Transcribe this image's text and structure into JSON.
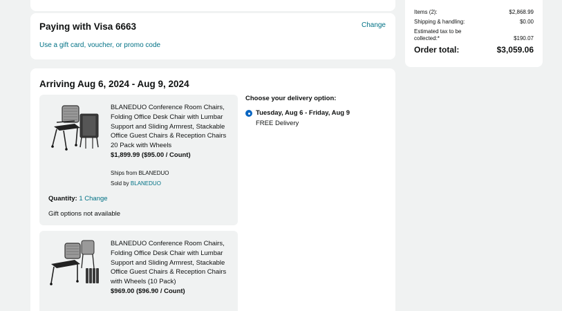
{
  "payment": {
    "title": "Paying with Visa 6663",
    "change_label": "Change",
    "gift_link": "Use a gift card, voucher, or promo code"
  },
  "shipment": {
    "arriving": "Arriving Aug 6, 2024 - Aug 9, 2024",
    "delivery_heading": "Choose your delivery option:",
    "delivery_option": {
      "date": "Tuesday, Aug 6 - Friday, Aug 9",
      "fee": "FREE Delivery"
    },
    "items": [
      {
        "title": "BLANEDUO Conference Room Chairs, Folding Office Desk Chair with Lumbar Support and Sliding Armrest, Stackable Office Guest Chairs & Reception Chairs 20 Pack with Wheels",
        "price": "$1,899.99 ($95.00 / Count)",
        "ships_from": "Ships from BLANEDUO",
        "sold_by_label": "Sold by ",
        "sold_by": "BLANEDUO",
        "quantity_label": "Quantity:",
        "quantity": "1",
        "quantity_change": "Change",
        "gift_options": "Gift options not available"
      },
      {
        "title": "BLANEDUO Conference Room Chairs, Folding Office Desk Chair with Lumbar Support and Sliding Armrest, Stackable Office Guest Chairs & Reception Chairs with Wheels (10 Pack)",
        "price": "$969.00 ($96.90 / Count)"
      }
    ]
  },
  "summary": {
    "items_label": "Items (2):",
    "items_value": "$2,868.99",
    "shipping_label": "Shipping & handling:",
    "shipping_value": "$0.00",
    "tax_label": "Estimated tax to be collected:*",
    "tax_value": "$190.07",
    "total_label": "Order total:",
    "total_value": "$3,059.06"
  },
  "colors": {
    "link": "#007185",
    "page_bg": "#f0f2f2",
    "radio_selected": "#0a66c2"
  }
}
